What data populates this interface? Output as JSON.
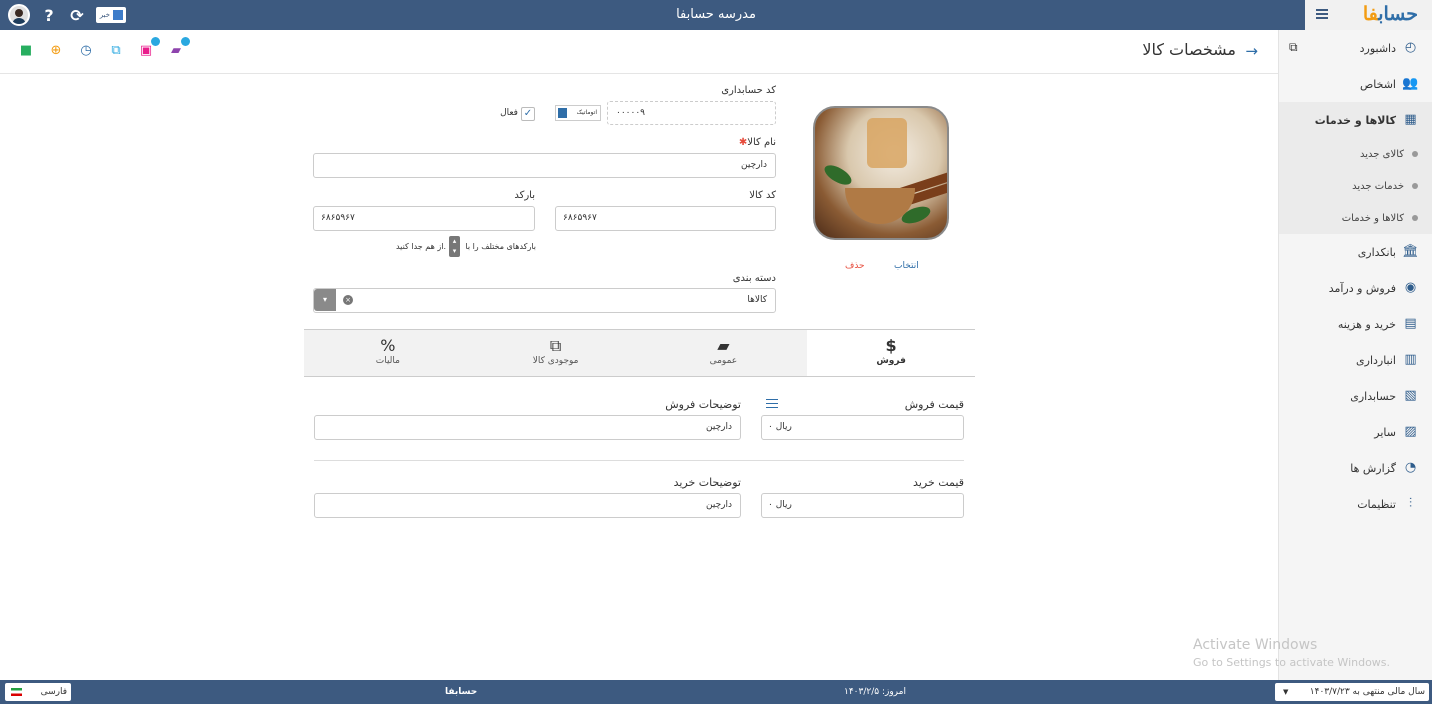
{
  "app": {
    "school_title": "مدرسه حسابفا",
    "logo_main": "حساب",
    "logo_accent": "فا",
    "news_label": "خبر"
  },
  "header": {
    "page_title": "مشخصات کالا"
  },
  "sidebar": {
    "items": [
      {
        "label": "داشبورد",
        "icon": "dashboard-icon"
      },
      {
        "label": "اشخاص",
        "icon": "people-icon"
      },
      {
        "label": "کالاها و خدمات",
        "icon": "box-icon"
      },
      {
        "label": "بانکداری",
        "icon": "bank-icon"
      },
      {
        "label": "فروش و درآمد",
        "icon": "sales-icon"
      },
      {
        "label": "خرید و هزینه",
        "icon": "purchase-icon"
      },
      {
        "label": "انبارداری",
        "icon": "warehouse-icon"
      },
      {
        "label": "حسابداری",
        "icon": "accounting-icon"
      },
      {
        "label": "سایر",
        "icon": "other-icon"
      },
      {
        "label": "گزارش ها",
        "icon": "report-icon"
      },
      {
        "label": "تنظیمات",
        "icon": "settings-icon"
      }
    ],
    "sub_items": [
      "کالای جدید",
      "خدمات جدید",
      "کالاها و خدمات"
    ]
  },
  "form": {
    "accounting_code_label": "کد حسابداری",
    "accounting_code_value": "۰۰۰۰۰۹",
    "auto_label": "اتوماتیک",
    "active_label": "فعال",
    "name_label": "نام کالا",
    "name_value": "دارچین",
    "code_label": "کد کالا",
    "code_value": "۶۸۶۵۹۶۷",
    "barcode_label": "بارکد",
    "barcode_value": "۶۸۶۵۹۶۷",
    "barcode_hint_a": "بارکدهای مختلف را با",
    "barcode_hint_b": "از هم جدا کنید.",
    "category_label": "دسته بندی",
    "category_value": "کالاها",
    "select_link": "انتخاب",
    "delete_link": "حذف"
  },
  "tabs": [
    {
      "label": "فروش",
      "active": true
    },
    {
      "label": "عمومی",
      "active": false
    },
    {
      "label": "موجودی کالا",
      "active": false
    },
    {
      "label": "مالیات",
      "active": false
    }
  ],
  "sale": {
    "price_label": "قیمت فروش",
    "price_value": "۰ ریال",
    "desc_label": "توضیحات فروش",
    "desc_value": "دارچین"
  },
  "purchase": {
    "price_label": "قیمت خرید",
    "price_value": "۰ ریال",
    "desc_label": "توضیحات خرید",
    "desc_value": "دارچین"
  },
  "footer": {
    "language": "فارسی",
    "brand": "حسابفا",
    "today": "امروز: ۱۴۰۳/۲/۵",
    "fiscal_year": "سال مالی منتهی به ۱۴۰۳/۷/۲۳"
  },
  "watermark": {
    "line1": "Activate Windows",
    "line2": "Go to Settings to activate Windows."
  }
}
